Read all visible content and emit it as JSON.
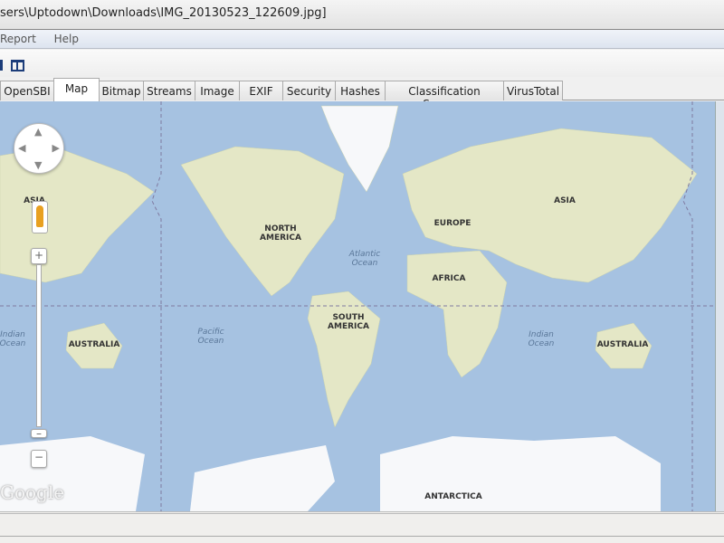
{
  "window": {
    "title": "sers\\Uptodown\\Downloads\\IMG_20130523_122609.jpg]"
  },
  "menu": [
    "Report",
    "Help"
  ],
  "tabs": [
    {
      "label": "OpenSBI",
      "active": false
    },
    {
      "label": "Map",
      "active": true
    },
    {
      "label": "Bitmap",
      "active": false
    },
    {
      "label": "Streams",
      "active": false
    },
    {
      "label": "Image",
      "active": false
    },
    {
      "label": "EXIF",
      "active": false
    },
    {
      "label": "Security",
      "active": false
    },
    {
      "label": "Hashes",
      "active": false
    },
    {
      "label": "Classification Sources",
      "active": false
    },
    {
      "label": "VirusTotal",
      "active": false
    }
  ],
  "map": {
    "continents": {
      "north_america": "NORTH AMERICA",
      "europe": "EUROPE",
      "asia": "ASIA",
      "asia_left": "ASIA",
      "africa": "AFRICA",
      "south_america": "SOUTH AMERICA",
      "australia": "AUSTRALIA",
      "australia_left": "AUSTRALIA",
      "antarctica": "ANTARCTICA"
    },
    "oceans": {
      "atlantic": "Atlantic Ocean",
      "pacific": "Pacific Ocean",
      "indian": "Indian Ocean",
      "indian_left": "Indian Ocean"
    },
    "zoom_in": "+",
    "zoom_out": "−",
    "logo": "Google"
  },
  "colors": {
    "water": "#a6c2e1",
    "land": "#e4e7c6",
    "forest": "#cfe0b0",
    "ice": "#f7f8fa"
  }
}
